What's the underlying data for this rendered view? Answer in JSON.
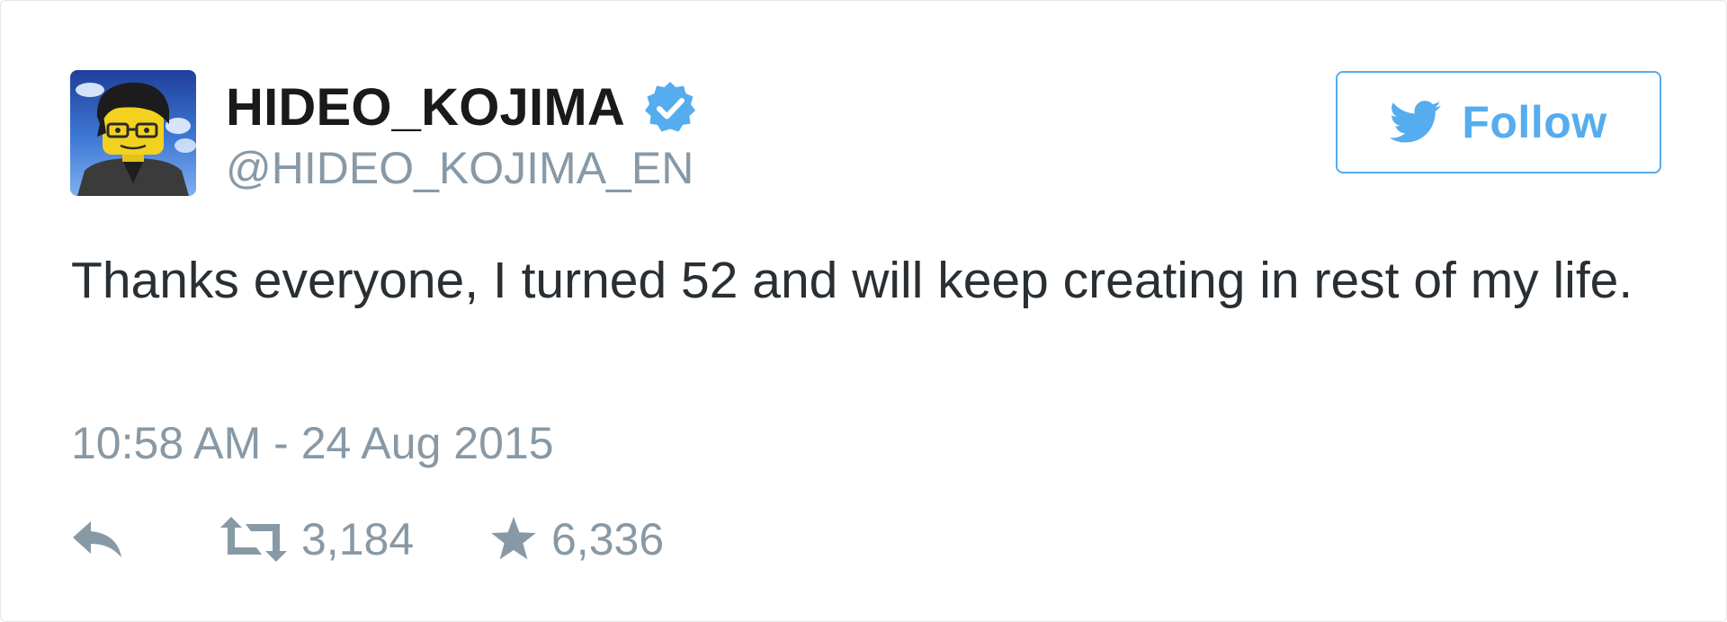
{
  "colors": {
    "accent": "#55acee",
    "verified": "#55acee",
    "text": "#292f33",
    "muted": "#8899a6",
    "border": "#e1e8ed"
  },
  "user": {
    "display_name": "HIDEO_KOJIMA",
    "screen_name": "@HIDEO_KOJIMA_EN",
    "verified_icon": "verified-badge-icon",
    "avatar_icon": "lego-avatar"
  },
  "follow_button": {
    "label": "Follow",
    "icon": "twitter-bird-icon"
  },
  "tweet": {
    "text": "Thanks everyone, I turned 52 and will keep creating in rest of my life.",
    "timestamp": "10:58 AM - 24 Aug 2015"
  },
  "actions": {
    "reply": {
      "icon": "reply-icon"
    },
    "retweet": {
      "icon": "retweet-icon",
      "count": "3,184"
    },
    "favorite": {
      "icon": "star-icon",
      "count": "6,336"
    }
  }
}
